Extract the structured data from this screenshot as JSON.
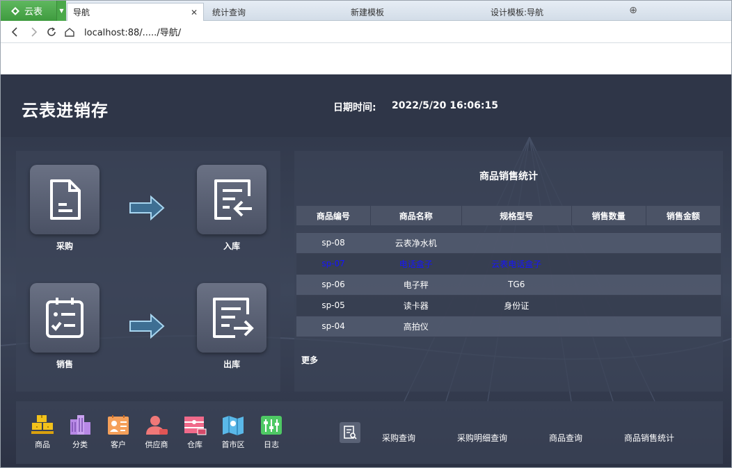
{
  "browser": {
    "brand_label": "云表",
    "active_tab": "导航",
    "tabs": [
      "统计查询",
      "新建模板",
      "设计模板:导航"
    ],
    "url": "localhost:88/...../导航/"
  },
  "header": {
    "title": "云表进销存",
    "datetime_label": "日期时间:",
    "datetime_value": "2022/5/20 16:06:15"
  },
  "flow": {
    "purchase": "采购",
    "inbound": "入库",
    "sales": "销售",
    "outbound": "出库"
  },
  "stats": {
    "title": "商品销售统计",
    "columns": [
      "商品编号",
      "商品名称",
      "规格型号",
      "销售数量",
      "销售金额"
    ],
    "rows": [
      [
        "sp-08",
        "云表净水机",
        "",
        "",
        ""
      ],
      [
        "sp-07",
        "电话盒子",
        "云表电话盒子",
        "",
        ""
      ],
      [
        "sp-06",
        "电子秤",
        "TG6",
        "",
        ""
      ],
      [
        "sp-05",
        "读卡器",
        "身份证",
        "",
        ""
      ],
      [
        "sp-04",
        "高拍仪",
        "",
        "",
        ""
      ]
    ],
    "more": "更多"
  },
  "shortcuts": [
    "商品",
    "分类",
    "客户",
    "供应商",
    "仓库",
    "首市区",
    "日志"
  ],
  "queries": [
    "采购查询",
    "采购明细查询",
    "商品查询",
    "商品销售统计"
  ],
  "colors": {
    "brand_green": "#4aa84a",
    "dash_bg": "#2d3446",
    "highlight_row_text": "#1515ff"
  }
}
